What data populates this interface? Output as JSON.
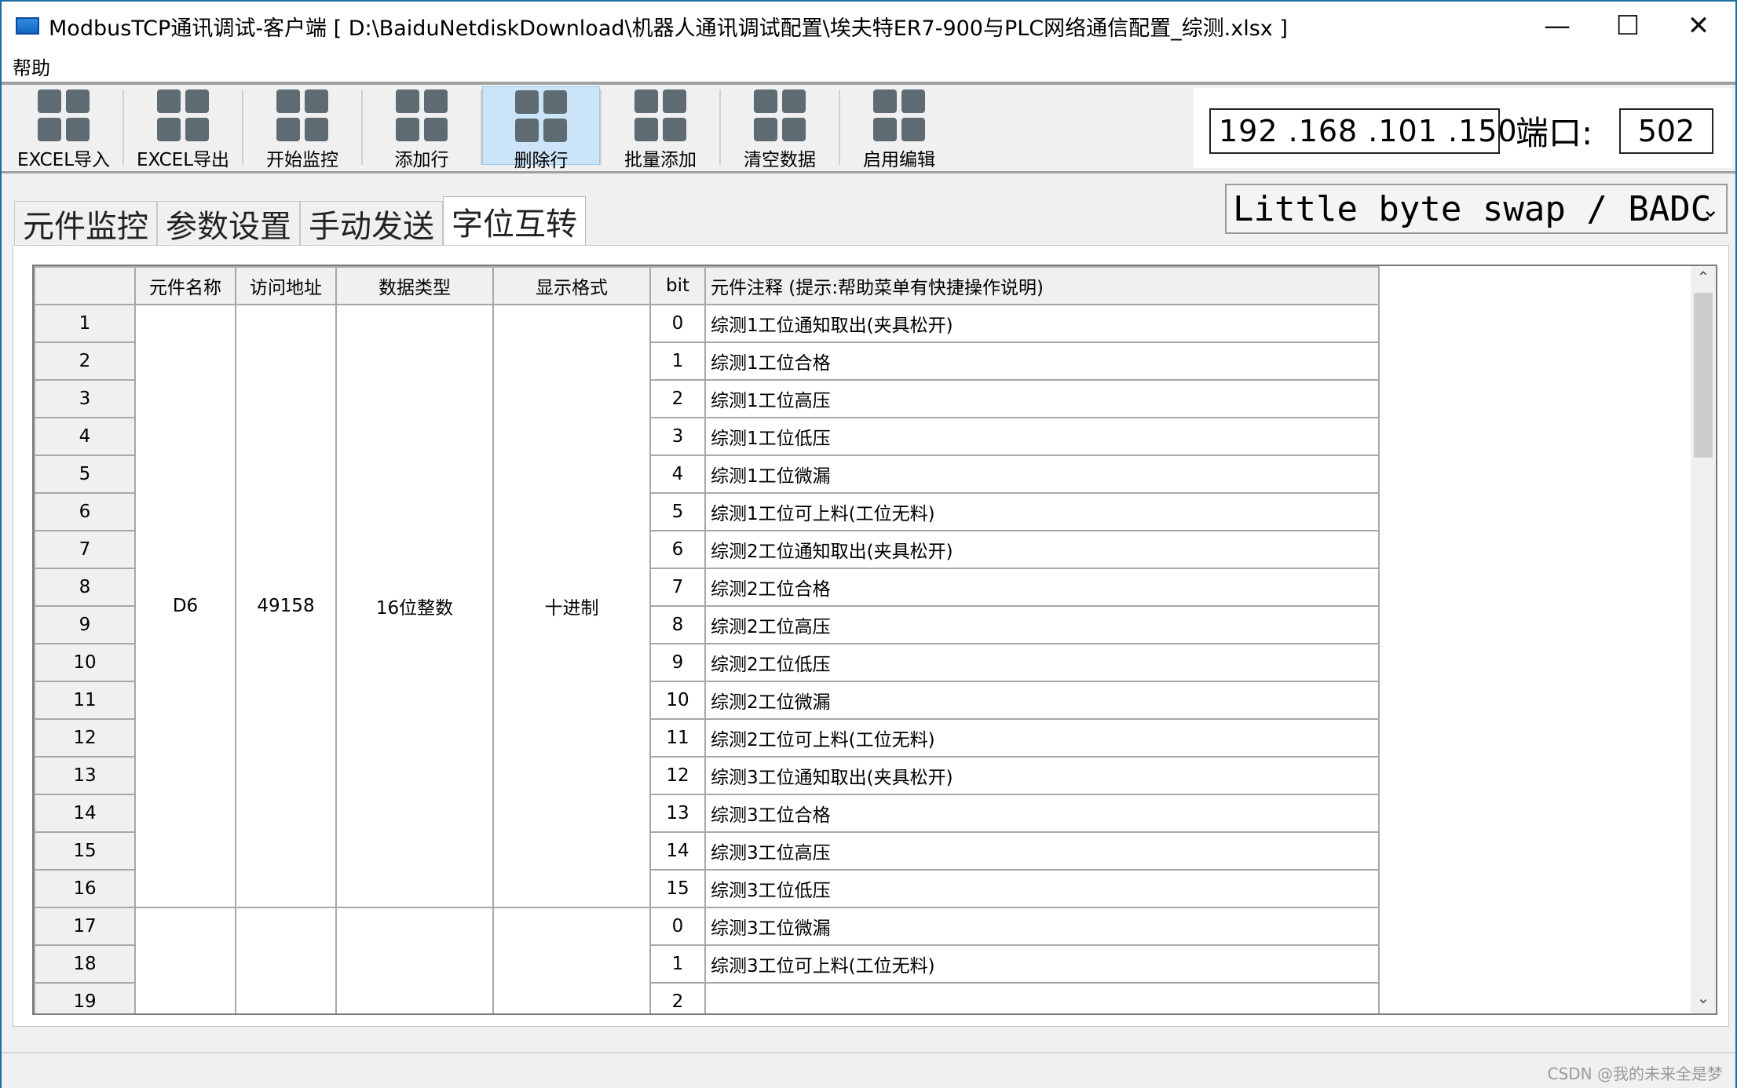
{
  "window": {
    "title": "ModbusTCP通讯调试-客户端  [ D:\\BaiduNetdiskDownload\\机器人通讯调试配置\\埃夫特ER7-900与PLC网络通信配置_综测.xlsx ]",
    "minimize": "—",
    "maximize": "☐",
    "close": "✕"
  },
  "menu": {
    "help": "帮助"
  },
  "toolbar": {
    "items": [
      {
        "label": "EXCEL导入"
      },
      {
        "label": "EXCEL导出"
      },
      {
        "label": "开始监控"
      },
      {
        "label": "添加行"
      },
      {
        "label": "删除行"
      },
      {
        "label": "批量添加"
      },
      {
        "label": "清空数据"
      },
      {
        "label": "启用编辑"
      }
    ]
  },
  "connection": {
    "ip": "192 .168 .101 .150",
    "port_label": "端口:",
    "port": "502"
  },
  "tabs": [
    "元件监控",
    "参数设置",
    "手动发送",
    "字位互转"
  ],
  "active_tab": "字位互转",
  "byte_order": {
    "selected": "Little byte swap / BADC"
  },
  "grid": {
    "headers": [
      "",
      "元件名称",
      "访问地址",
      "数据类型",
      "显示格式",
      "bit",
      "元件注释 (提示:帮助菜单有快捷操作说明)"
    ],
    "group1": {
      "name": "D6",
      "address": "49158",
      "type": "16位整数",
      "format": "十进制"
    },
    "rows": [
      {
        "n": "1",
        "bit": "0",
        "comment": "综测1工位通知取出(夹具松开)"
      },
      {
        "n": "2",
        "bit": "1",
        "comment": "综测1工位合格"
      },
      {
        "n": "3",
        "bit": "2",
        "comment": "综测1工位高压"
      },
      {
        "n": "4",
        "bit": "3",
        "comment": "综测1工位低压"
      },
      {
        "n": "5",
        "bit": "4",
        "comment": "综测1工位微漏"
      },
      {
        "n": "6",
        "bit": "5",
        "comment": "综测1工位可上料(工位无料)"
      },
      {
        "n": "7",
        "bit": "6",
        "comment": "综测2工位通知取出(夹具松开)"
      },
      {
        "n": "8",
        "bit": "7",
        "comment": "综测2工位合格"
      },
      {
        "n": "9",
        "bit": "8",
        "comment": "综测2工位高压"
      },
      {
        "n": "10",
        "bit": "9",
        "comment": "综测2工位低压"
      },
      {
        "n": "11",
        "bit": "10",
        "comment": "综测2工位微漏"
      },
      {
        "n": "12",
        "bit": "11",
        "comment": "综测2工位可上料(工位无料)"
      },
      {
        "n": "13",
        "bit": "12",
        "comment": "综测3工位通知取出(夹具松开)"
      },
      {
        "n": "14",
        "bit": "13",
        "comment": "综测3工位合格"
      },
      {
        "n": "15",
        "bit": "14",
        "comment": "综测3工位高压"
      },
      {
        "n": "16",
        "bit": "15",
        "comment": "综测3工位低压"
      },
      {
        "n": "17",
        "bit": "0",
        "comment": "综测3工位微漏"
      },
      {
        "n": "18",
        "bit": "1",
        "comment": "综测3工位可上料(工位无料)"
      },
      {
        "n": "19",
        "bit": "2",
        "comment": ""
      }
    ]
  },
  "watermark": "CSDN @我的未来全是梦"
}
